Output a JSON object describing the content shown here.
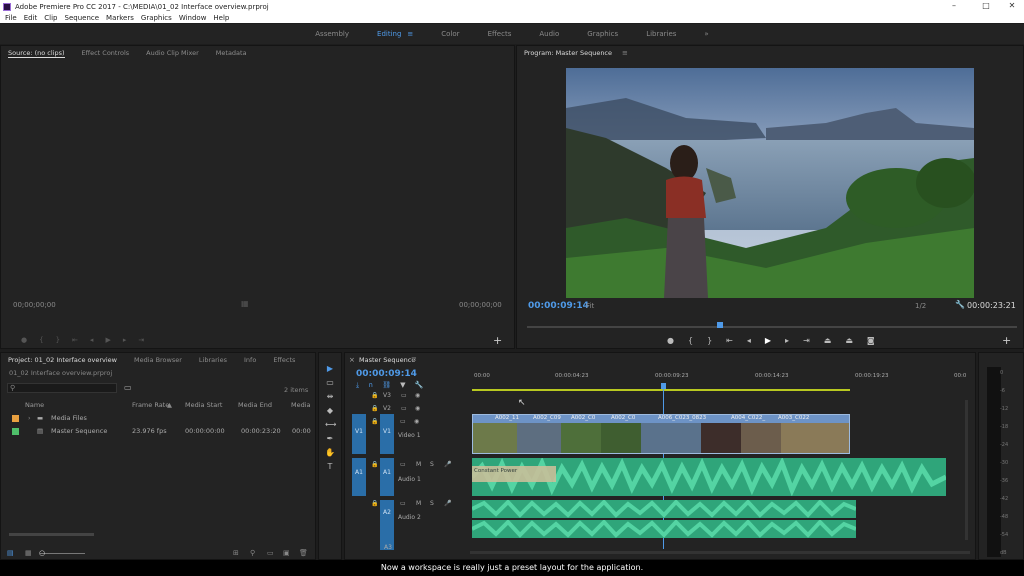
{
  "app": {
    "title": "Adobe Premiere Pro CC 2017 - C:\\MEDIA\\01_02 Interface overview.prproj",
    "menus": [
      "File",
      "Edit",
      "Clip",
      "Sequence",
      "Markers",
      "Graphics",
      "Window",
      "Help"
    ],
    "window_controls": [
      "–",
      "□",
      "✕"
    ]
  },
  "workspaces": {
    "items": [
      "Assembly",
      "Editing",
      "Color",
      "Effects",
      "Audio",
      "Graphics",
      "Libraries"
    ],
    "active": "Editing",
    "overflow": "»"
  },
  "source_panel": {
    "tabs": [
      "Source: (no clips)",
      "Effect Controls",
      "Audio Clip Mixer",
      "Metadata"
    ],
    "timecode_left": "00;00;00;00",
    "timecode_right": "00;00;00;00"
  },
  "program_panel": {
    "tab": "Program: Master Sequence",
    "timecode_current": "00:00:09:14",
    "fit": "Fit",
    "resolution": "1/2",
    "timecode_duration": "00:00:23:21"
  },
  "project_panel": {
    "tabs": [
      "Project: 01_02 Interface overview",
      "Media Browser",
      "Libraries",
      "Info",
      "Effects"
    ],
    "file": "01_02 Interface overview.prproj",
    "item_count": "2 items",
    "columns": [
      "Name",
      "Frame Rate",
      "Media Start",
      "Media End",
      "Media"
    ],
    "rows": [
      {
        "name": "Media Files",
        "frame_rate": "",
        "start": "",
        "end": "",
        "color": "#e8a040"
      },
      {
        "name": "Master Sequence",
        "frame_rate": "23.976 fps",
        "start": "00:00:00:00",
        "end": "00:00:23:20",
        "extra": "00:00",
        "color": "#4fbf6a"
      }
    ]
  },
  "timeline": {
    "tab": "Master Sequence",
    "timecode": "00:00:09:14",
    "ruler": [
      "00:00",
      "00:00:04:23",
      "00:00:09:23",
      "00:00:14:23",
      "00:00:19:23",
      "00:0"
    ],
    "tracks": {
      "video": [
        "V3",
        "V2",
        "V1"
      ],
      "audio": [
        "A1",
        "A2",
        "A3"
      ],
      "source_v": "V1",
      "source_a": "A1",
      "video1_label": "Video 1",
      "audio1_label": "Audio 1",
      "audio2_label": "Audio 2"
    },
    "video_clips": [
      "A002_11",
      "A002_C09",
      "A002_C0",
      "A002_C0",
      "A006_C023_0823",
      "A004_C022_",
      "A003_C022"
    ],
    "audio_clip_label": "Constant Power"
  },
  "meter_ticks": [
    "0",
    "-6",
    "-12",
    "-18",
    "-24",
    "-30",
    "-36",
    "-42",
    "-48",
    "-54",
    "dB"
  ],
  "subtitle": "Now a workspace is really just a preset layout for the application.",
  "colors": {
    "accent": "#4f9ae8",
    "video_clip": "#7aa0d0",
    "audio_clip": "#3ec190",
    "media_files_label": "#e8a040",
    "sequence_label": "#4fbf6a"
  }
}
